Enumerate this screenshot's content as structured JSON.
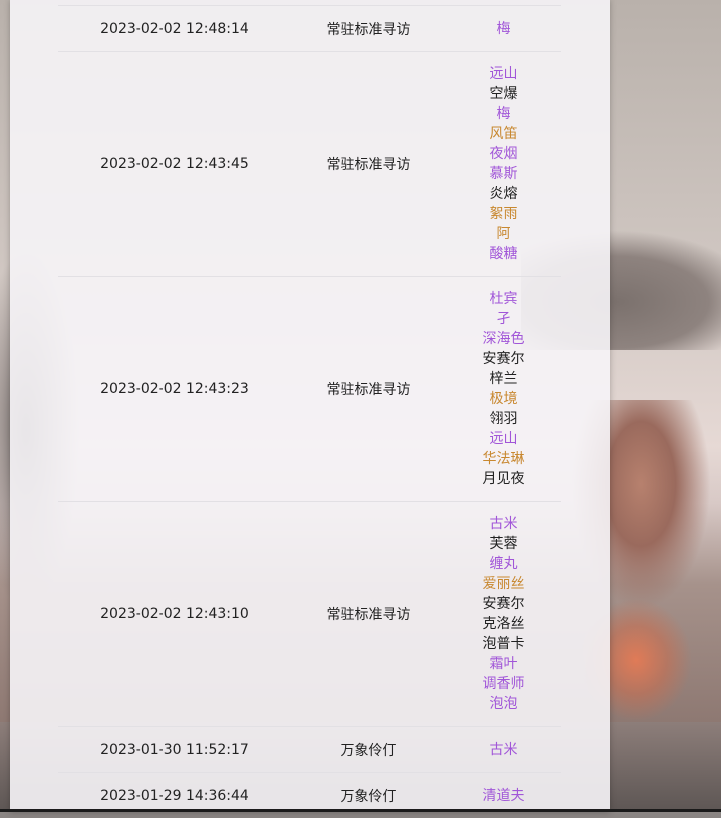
{
  "colors": {
    "purple": "#a156d8",
    "gold": "#c88830",
    "black": "#222222"
  },
  "records": [
    {
      "time": "2023-02-02 12:48:14",
      "pool": "常驻标准寻访",
      "items": [
        {
          "name": "梅",
          "rarity": "r5"
        }
      ]
    },
    {
      "time": "2023-02-02 12:43:45",
      "pool": "常驻标准寻访",
      "items": [
        {
          "name": "远山",
          "rarity": "r5"
        },
        {
          "name": "空爆",
          "rarity": "r3"
        },
        {
          "name": "梅",
          "rarity": "r5"
        },
        {
          "name": "风笛",
          "rarity": "r4"
        },
        {
          "name": "夜烟",
          "rarity": "r5"
        },
        {
          "name": "慕斯",
          "rarity": "r5"
        },
        {
          "name": "炎熔",
          "rarity": "r3"
        },
        {
          "name": "絮雨",
          "rarity": "r4"
        },
        {
          "name": "阿",
          "rarity": "r4"
        },
        {
          "name": "酸糖",
          "rarity": "r5"
        }
      ]
    },
    {
      "time": "2023-02-02 12:43:23",
      "pool": "常驻标准寻访",
      "items": [
        {
          "name": "杜宾",
          "rarity": "r5"
        },
        {
          "name": "孑",
          "rarity": "r5"
        },
        {
          "name": "深海色",
          "rarity": "r5"
        },
        {
          "name": "安赛尔",
          "rarity": "r3"
        },
        {
          "name": "梓兰",
          "rarity": "r3"
        },
        {
          "name": "极境",
          "rarity": "r4"
        },
        {
          "name": "翎羽",
          "rarity": "r3"
        },
        {
          "name": "远山",
          "rarity": "r5"
        },
        {
          "name": "华法琳",
          "rarity": "r4"
        },
        {
          "name": "月见夜",
          "rarity": "r3"
        }
      ]
    },
    {
      "time": "2023-02-02 12:43:10",
      "pool": "常驻标准寻访",
      "items": [
        {
          "name": "古米",
          "rarity": "r5"
        },
        {
          "name": "芙蓉",
          "rarity": "r3"
        },
        {
          "name": "缠丸",
          "rarity": "r5"
        },
        {
          "name": "爱丽丝",
          "rarity": "r4"
        },
        {
          "name": "安赛尔",
          "rarity": "r3"
        },
        {
          "name": "克洛丝",
          "rarity": "r3"
        },
        {
          "name": "泡普卡",
          "rarity": "r3"
        },
        {
          "name": "霜叶",
          "rarity": "r5"
        },
        {
          "name": "调香师",
          "rarity": "r5"
        },
        {
          "name": "泡泡",
          "rarity": "r5"
        }
      ]
    },
    {
      "time": "2023-01-30 11:52:17",
      "pool": "万象伶仃",
      "items": [
        {
          "name": "古米",
          "rarity": "r5"
        }
      ]
    },
    {
      "time": "2023-01-29 14:36:44",
      "pool": "万象伶仃",
      "items": [
        {
          "name": "清道夫",
          "rarity": "r5"
        }
      ]
    }
  ]
}
